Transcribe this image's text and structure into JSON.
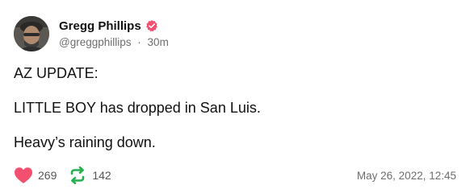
{
  "post": {
    "author": {
      "display_name": "Gregg Phillips",
      "handle": "@greggphillips",
      "separator": "·",
      "relative_time": "30m",
      "verified_icon": "verified-badge-icon"
    },
    "paragraphs": [
      "AZ UPDATE:",
      "LITTLE BOY has dropped in San Luis.",
      "Heavy’s raining down."
    ],
    "stats": {
      "likes": "269",
      "reposts": "142"
    },
    "timestamp": "May 26, 2022, 12:45"
  },
  "icons": {
    "like": "heart-icon",
    "repost": "repost-icon",
    "verified": "verified-badge-icon"
  },
  "colors": {
    "like": "#f2506e",
    "repost": "#22b14c",
    "verified": "#f2506e",
    "muted_text": "#6e6e6e"
  }
}
